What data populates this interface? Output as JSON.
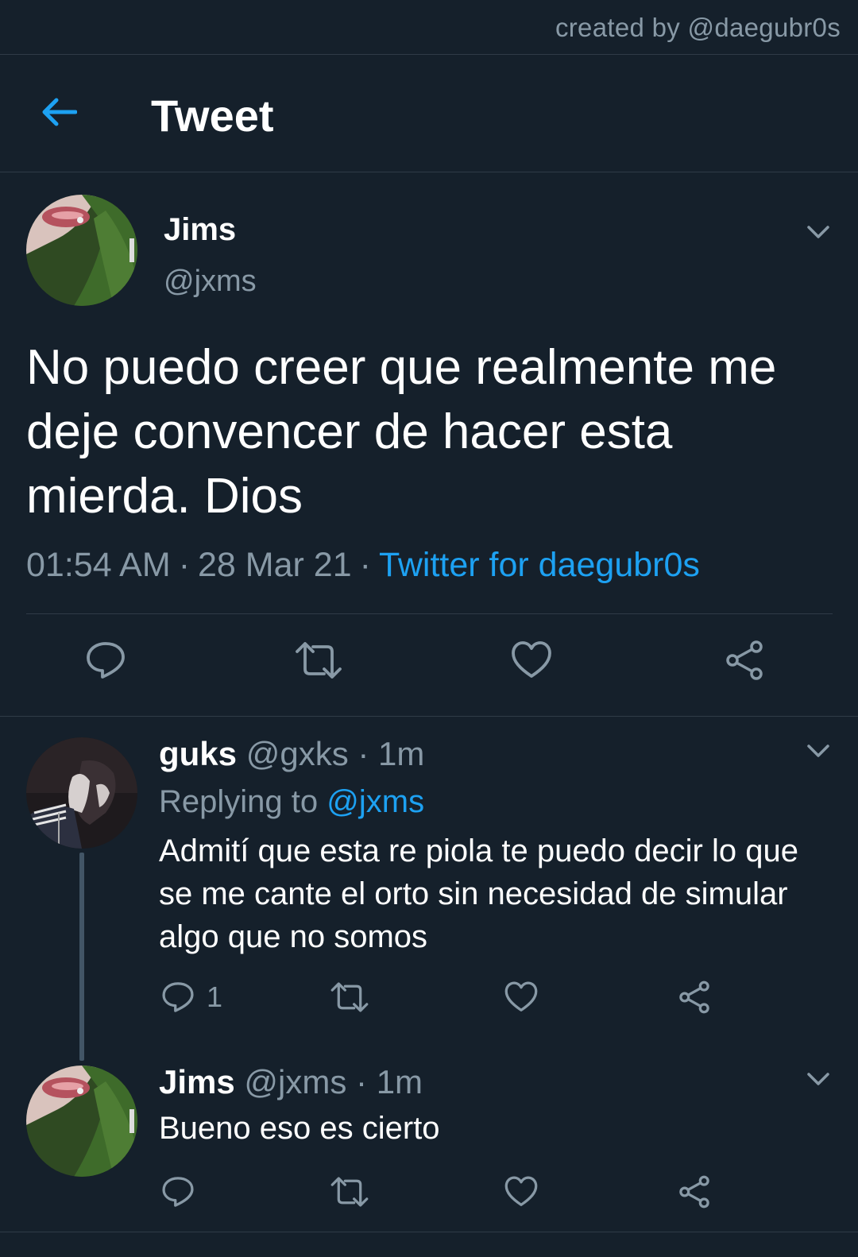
{
  "credit": "created by @daegubr0s",
  "header": {
    "title": "Tweet",
    "back_icon": "arrow-left-icon"
  },
  "main_tweet": {
    "name": "Jims",
    "handle": "@jxms",
    "text": "No puedo creer que realmente me deje convencer de hacer esta mierda. Dios",
    "time": "01:54 AM",
    "date": "28 Mar 21",
    "source": "Twitter for daegubr0s",
    "separator": "·"
  },
  "replies": [
    {
      "name": "guks",
      "handle": "@gxks",
      "time": "1m",
      "replying_prefix": "Replying to",
      "replying_to": "@jxms",
      "text": "Admití que esta re piola te puedo decir lo que se me cante el orto sin necesidad de simular algo que no somos",
      "reply_count": "1"
    },
    {
      "name": "Jims",
      "handle": "@jxms",
      "time": "1m",
      "text": "Bueno eso es cierto"
    }
  ],
  "colors": {
    "background": "#15202b",
    "muted": "#8899a6",
    "accent": "#1da1f2",
    "divider": "#2f3b47"
  },
  "icons": [
    "arrow-left-icon",
    "chevron-down-icon",
    "reply-icon",
    "retweet-icon",
    "like-icon",
    "share-icon"
  ]
}
